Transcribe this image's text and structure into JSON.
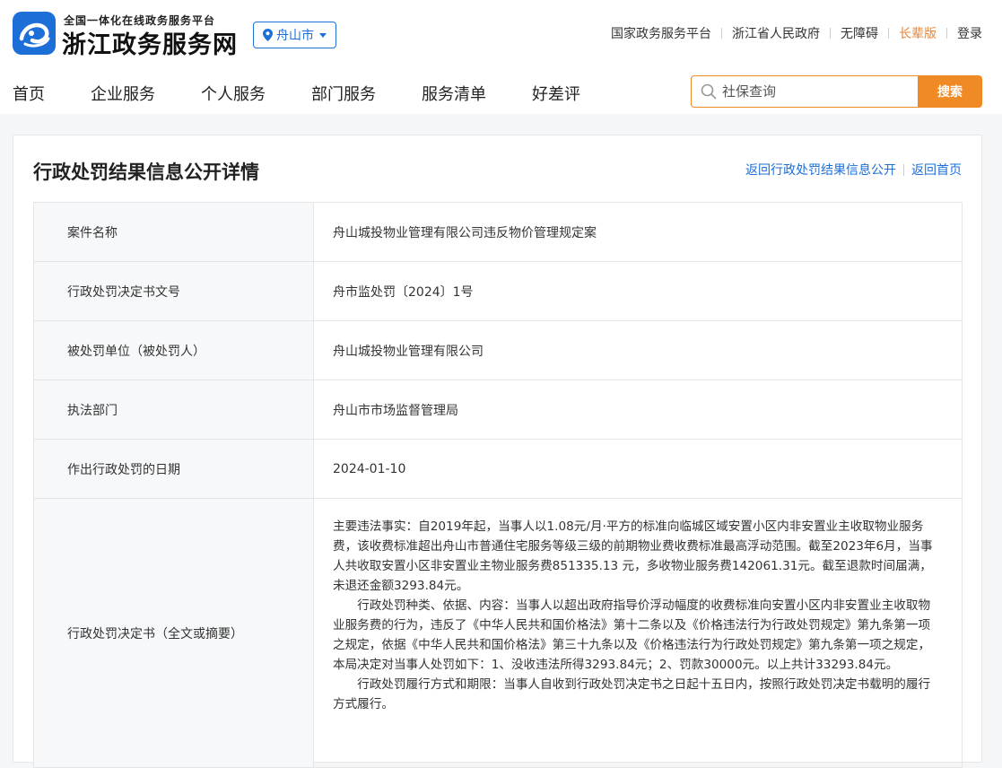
{
  "header": {
    "subtitle": "全国一体化在线政务服务平台",
    "site_name": "浙江政务服务网",
    "city": "舟山市",
    "top_links": [
      "国家政务服务平台",
      "浙江省人民政府",
      "无障碍",
      "长辈版",
      "登录"
    ],
    "brand_color": "#1d6fd8",
    "accent_color": "#f08a24"
  },
  "nav": {
    "items": [
      "首页",
      "企业服务",
      "个人服务",
      "部门服务",
      "服务清单",
      "好差评"
    ]
  },
  "search": {
    "placeholder": "社保查询",
    "button": "搜索"
  },
  "card": {
    "title": "行政处罚结果信息公开详情",
    "links": [
      "返回行政处罚结果信息公开",
      "返回首页"
    ]
  },
  "table": {
    "rows": [
      {
        "label": "案件名称",
        "value": "舟山城投物业管理有限公司违反物价管理规定案"
      },
      {
        "label": "行政处罚决定书文号",
        "value": "舟市监处罚〔2024〕1号"
      },
      {
        "label": "被处罚单位（被处罚人）",
        "value": "舟山城投物业管理有限公司"
      },
      {
        "label": "执法部门",
        "value": "舟山市市场监督管理局"
      },
      {
        "label": "作出行政处罚的日期",
        "value": "2024-01-10"
      },
      {
        "label": "行政处罚决定书（全文或摘要）",
        "paragraphs": [
          "主要违法事实：自2019年起，当事人以1.08元/月·平方的标准向临城区域安置小区内非安置业主收取物业服务费，该收费标准超出舟山市普通住宅服务等级三级的前期物业费收费标准最高浮动范围。截至2023年6月，当事人共收取安置小区非安置业主物业服务费851335.13 元，多收物业服务费142061.31元。截至退款时间届满，未退还金额3293.84元。",
          "行政处罚种类、依据、内容：当事人以超出政府指导价浮动幅度的收费标准向安置小区内非安置业主收取物业服务费的行为，违反了《中华人民共和国价格法》第十二条以及《价格违法行为行政处罚规定》第九条第一项之规定，依据《中华人民共和国价格法》第三十九条以及《价格违法行为行政处罚规定》第九条第一项之规定，本局决定对当事人处罚如下：1、没收违法所得3293.84元；2、罚款30000元。以上共计33293.84元。",
          "行政处罚履行方式和期限：当事人自收到行政处罚决定书之日起十五日内，按照行政处罚决定书载明的履行方式履行。"
        ]
      }
    ]
  }
}
